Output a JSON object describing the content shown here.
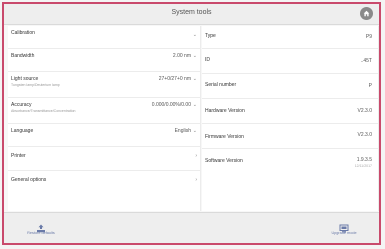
{
  "header": {
    "title": "System tools"
  },
  "left_rows": [
    {
      "label": "Calibration",
      "value": ""
    },
    {
      "label": "Bandwidth",
      "value": "2.00 nm"
    },
    {
      "label": "Light source",
      "sub": "Tungsten lamp/Deuterium lamp",
      "value": "27+0/27+0 nm"
    },
    {
      "label": "Accuracy",
      "sub": "Absorbance/Transmittance/Concentration",
      "value": "0.000/0.00%/0.00"
    },
    {
      "label": "Language",
      "value": "English"
    },
    {
      "label": "Printer",
      "value": ""
    },
    {
      "label": "General options",
      "value": ""
    }
  ],
  "right_rows": [
    {
      "label": "Type",
      "value": "P9"
    },
    {
      "label": "ID",
      "value": "..45T"
    },
    {
      "label": "Serial number",
      "value": "P"
    },
    {
      "label": "Hardware Version",
      "value": "V2.3.0"
    },
    {
      "label": "Firmware Version",
      "value": "V2.3.0"
    },
    {
      "label": "Software Version",
      "value": "1.9.3.5",
      "value2": "12/11/2017"
    }
  ],
  "footer": {
    "restore_label": "Restore defaults",
    "upgrade_label": "Upgrade mode"
  },
  "colors": {
    "frame": "#c94a6c",
    "footer_text": "#6a7aa8"
  },
  "icons": {
    "home": "home-icon",
    "restore": "restore-icon",
    "upgrade": "upgrade-icon",
    "chevron": "chevron-right-icon"
  }
}
